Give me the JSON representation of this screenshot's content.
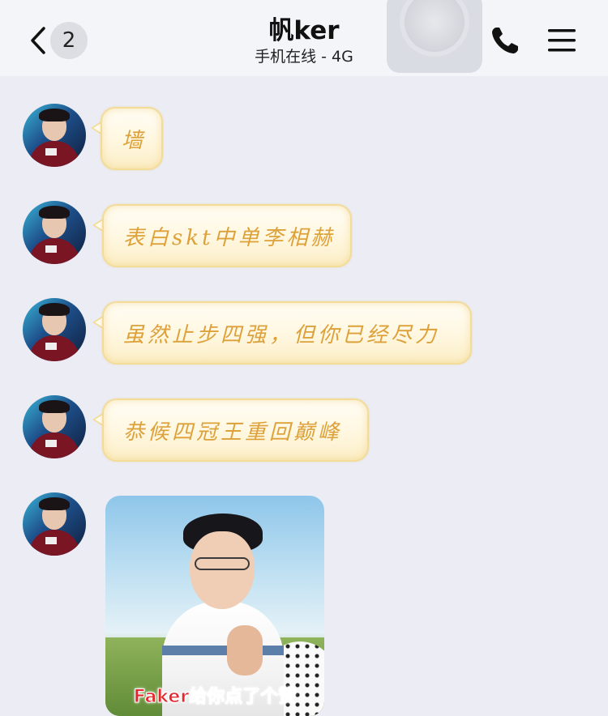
{
  "header": {
    "back_icon": "chevron-left-icon",
    "unread_count": "2",
    "title": "帆ker",
    "status": "手机在线 - 4G",
    "phone_icon": "phone-icon",
    "menu_icon": "menu-icon"
  },
  "messages": [
    {
      "type": "text",
      "text": "墙"
    },
    {
      "type": "text",
      "text": "表白skt中单李相赫"
    },
    {
      "type": "text",
      "text": "虽然止步四强，但你已经尽力"
    },
    {
      "type": "text",
      "text": "恭候四冠王重回巅峰"
    },
    {
      "type": "image",
      "caption": "Faker给你点了个赞"
    }
  ],
  "colors": {
    "background": "#ececf4",
    "bubble_text": "#dda13a",
    "bubble_border": "#f2dc97",
    "caption": "#e4262f"
  }
}
